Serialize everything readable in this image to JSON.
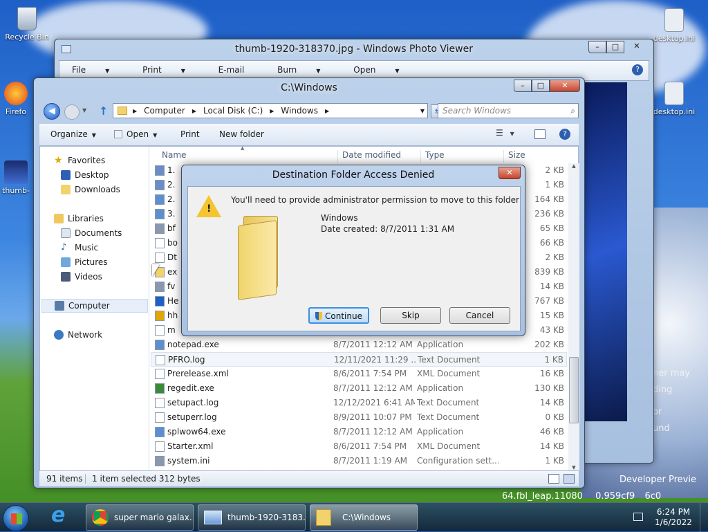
{
  "desktop": {
    "icons": [
      "Recycle Bin",
      "Firefo",
      "thumb-",
      "desktop.ini",
      "desktop.ini"
    ],
    "bg_text": [
      "ner may",
      "ding",
      "or",
      "und",
      "Developer Previe",
      "64.fbl_leap.11080",
      "0.959cf9",
      "6c0"
    ]
  },
  "photo_viewer": {
    "title": "thumb-1920-318370.jpg - Windows Photo Viewer",
    "menu": [
      "File",
      "Print",
      "E-mail",
      "Burn",
      "Open"
    ]
  },
  "explorer": {
    "title": "C:\\Windows",
    "breadcrumb": [
      "Computer",
      "Local Disk (C:)",
      "Windows"
    ],
    "search_placeholder": "Search Windows",
    "toolbar": [
      "Organize",
      "Open",
      "Print",
      "New folder"
    ],
    "nav": {
      "favorites": "Favorites",
      "desktop": "Desktop",
      "downloads": "Downloads",
      "libraries": "Libraries",
      "documents": "Documents",
      "music": "Music",
      "pictures": "Pictures",
      "videos": "Videos",
      "computer": "Computer",
      "network": "Network"
    },
    "columns": {
      "name": "Name",
      "date": "Date modified",
      "type": "Type",
      "size": "Size"
    },
    "rows": [
      {
        "name": "1.",
        "date": "",
        "type": "",
        "size": "2 KB"
      },
      {
        "name": "2.",
        "date": "",
        "type": "",
        "size": "1 KB"
      },
      {
        "name": "2.",
        "date": "",
        "type": "",
        "size": "164 KB"
      },
      {
        "name": "3.",
        "date": "",
        "type": "",
        "size": "236 KB"
      },
      {
        "name": "bf",
        "date": "",
        "type": "",
        "size": "65 KB"
      },
      {
        "name": "bo",
        "date": "",
        "type": "",
        "size": "66 KB"
      },
      {
        "name": "Dt",
        "date": "",
        "type": "",
        "size": "2 KB"
      },
      {
        "name": "ex",
        "date": "",
        "type": "",
        "size": "839 KB"
      },
      {
        "name": "fv",
        "date": "",
        "type": "",
        "size": "14 KB"
      },
      {
        "name": "He",
        "date": "",
        "type": "",
        "size": "767 KB"
      },
      {
        "name": "hh",
        "date": "",
        "type": "",
        "size": "15 KB"
      },
      {
        "name": "m",
        "date": "",
        "type": "",
        "size": "43 KB"
      },
      {
        "name": "notepad.exe",
        "date": "8/7/2011 12:12 AM",
        "type": "Application",
        "size": "202 KB"
      },
      {
        "name": "PFRO.log",
        "date": "12/11/2021 11:29 ...",
        "type": "Text Document",
        "size": "1 KB"
      },
      {
        "name": "Prerelease.xml",
        "date": "8/6/2011 7:54 PM",
        "type": "XML Document",
        "size": "16 KB"
      },
      {
        "name": "regedit.exe",
        "date": "8/7/2011 12:12 AM",
        "type": "Application",
        "size": "130 KB"
      },
      {
        "name": "setupact.log",
        "date": "12/12/2021 6:41 AM",
        "type": "Text Document",
        "size": "14 KB"
      },
      {
        "name": "setuperr.log",
        "date": "8/9/2011 10:07 PM",
        "type": "Text Document",
        "size": "0 KB"
      },
      {
        "name": "splwow64.exe",
        "date": "8/7/2011 12:12 AM",
        "type": "Application",
        "size": "46 KB"
      },
      {
        "name": "Starter.xml",
        "date": "8/6/2011 7:54 PM",
        "type": "XML Document",
        "size": "14 KB"
      },
      {
        "name": "system.ini",
        "date": "8/7/2011 1:19 AM",
        "type": "Configuration sett...",
        "size": "1 KB"
      }
    ],
    "status": {
      "items": "91 items",
      "selected": "1 item selected  312 bytes"
    }
  },
  "dialog": {
    "title": "Destination Folder Access Denied",
    "message": "You'll need to provide administrator permission to move to this folder",
    "folder_name": "Windows",
    "date_created": "Date created: 8/7/2011 1:31 AM",
    "buttons": {
      "continue": "Continue",
      "skip": "Skip",
      "cancel": "Cancel"
    }
  },
  "taskbar": {
    "items": [
      "super mario galax...",
      "thumb-1920-3183...",
      "C:\\Windows"
    ],
    "time": "6:24 PM",
    "date": "1/6/2022"
  }
}
